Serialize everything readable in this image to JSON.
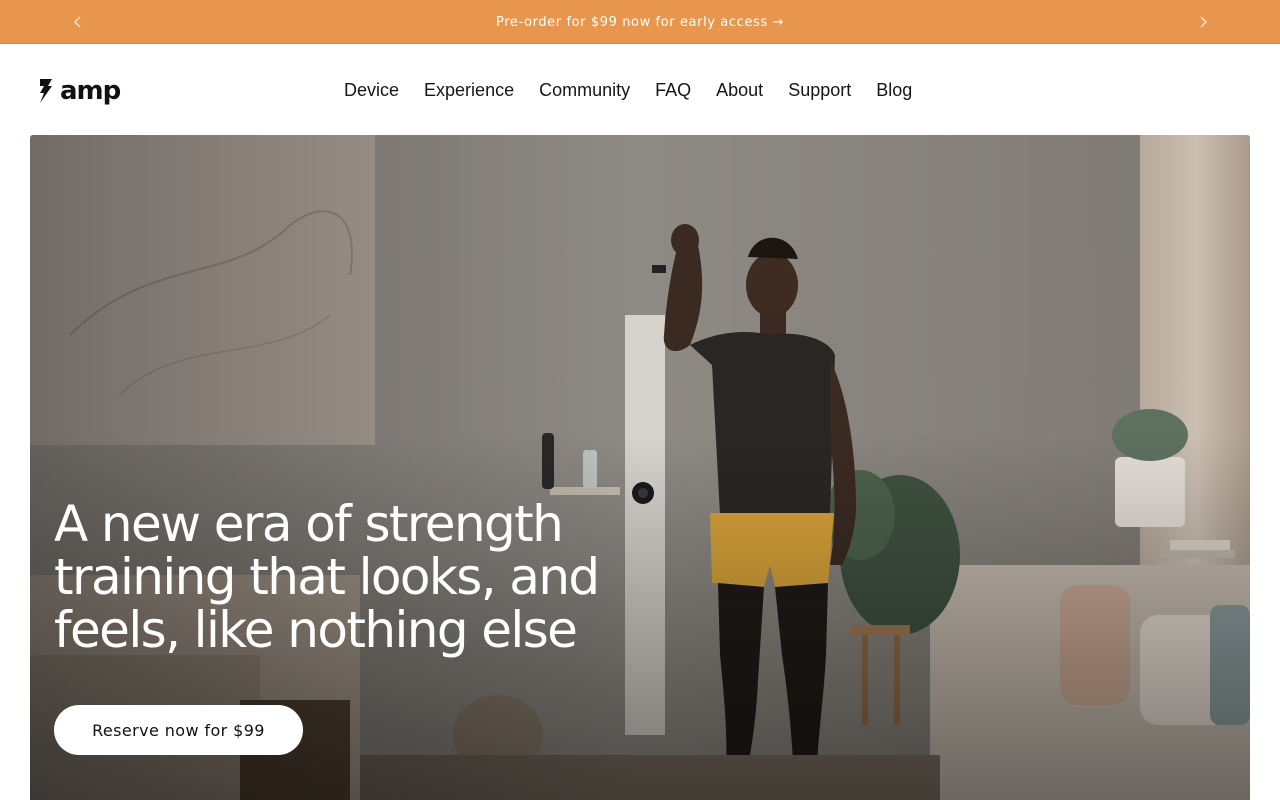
{
  "announcement": {
    "text": "Pre-order for $99 now for early access →",
    "prev_icon": "chevron-left-icon",
    "next_icon": "chevron-right-icon"
  },
  "brand": {
    "name": "amp",
    "icon": "amp-logo-icon"
  },
  "nav": {
    "items": [
      {
        "label": "Device"
      },
      {
        "label": "Experience"
      },
      {
        "label": "Community"
      },
      {
        "label": "FAQ"
      },
      {
        "label": "About"
      },
      {
        "label": "Support"
      },
      {
        "label": "Blog"
      }
    ]
  },
  "hero": {
    "headline": "A new era of strength training that looks, and feels, like nothing else",
    "cta_label": "Reserve now for $99",
    "image_description": "hero-photo-strength-training",
    "colors": {
      "wall": "#8d8982",
      "shorts": "#d9a43a",
      "accent": "#e8964e"
    }
  }
}
